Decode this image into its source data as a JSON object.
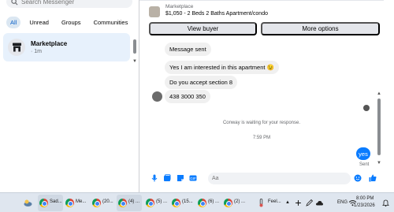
{
  "sidebar": {
    "search_placeholder": "Search Messenger",
    "filters": [
      "All",
      "Unread",
      "Groups",
      "Communities"
    ],
    "conversation": {
      "name": "Marketplace",
      "time": "· 1m"
    }
  },
  "chat": {
    "banner": {
      "title": "Marketplace",
      "listing": "$1,050 - 2 Beds 2 Baths Apartment/condo"
    },
    "buttons": {
      "view_buyer": "View buyer",
      "more_options": "More options"
    },
    "messages": [
      "Message sent",
      "Yes I am interested in this apartment 😉",
      "Do you accept section 8",
      "438 3000 350"
    ],
    "system_notice": "Conway is waiting for your response.",
    "timestamp": "7:59 PM",
    "my_message": "yes",
    "my_message_status": "Sent",
    "composer_placeholder": "Aa"
  },
  "taskbar": {
    "apps": [
      "Sad...",
      "Me...",
      "(20...",
      "(4) ...",
      "(5) ...",
      "(15...",
      "(6) ...",
      "(2) ..."
    ],
    "weather_label": "Feel...",
    "language": "ENG",
    "time": "8:00 PM",
    "date": "1/23/2026"
  },
  "colors": {
    "accent": "#0a7cff",
    "active_chip_bg": "#dbe7f2",
    "selected_conv_bg": "#e7f1fc"
  }
}
